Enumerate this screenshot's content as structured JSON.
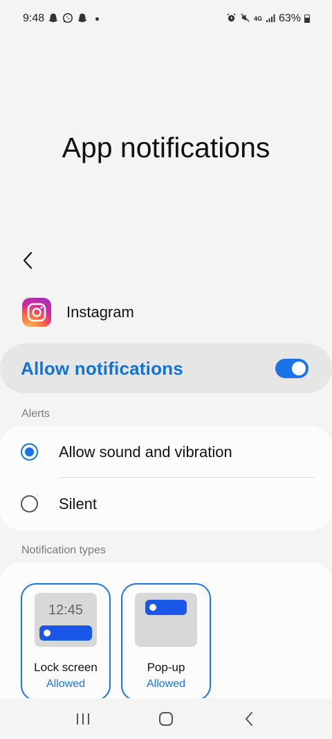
{
  "status_bar": {
    "time": "9:48",
    "battery": "63%",
    "left_icons": [
      "snapchat-icon",
      "whatsapp-icon",
      "snapchat-icon"
    ],
    "right_icons": [
      "alarm-icon",
      "mute-icon",
      "4g-icon",
      "signal-icon",
      "battery-icon"
    ],
    "network": "4G"
  },
  "page": {
    "title": "App notifications"
  },
  "app": {
    "name": "Instagram"
  },
  "allow": {
    "label": "Allow notifications",
    "enabled": true
  },
  "alerts": {
    "section_label": "Alerts",
    "options": [
      {
        "label": "Allow sound and vibration",
        "checked": true
      },
      {
        "label": "Silent",
        "checked": false
      }
    ]
  },
  "notification_types": {
    "section_label": "Notification types",
    "items": [
      {
        "label": "Lock screen",
        "status": "Allowed",
        "preview_time": "12:45"
      },
      {
        "label": "Pop-up",
        "status": "Allowed"
      }
    ]
  },
  "colors": {
    "accent": "#1a73e8",
    "background": "#f4f4f4"
  }
}
